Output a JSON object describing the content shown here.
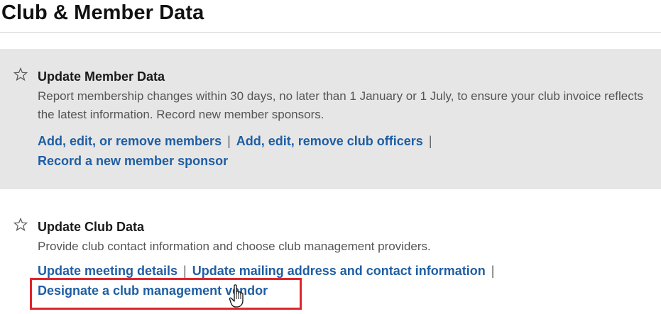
{
  "page": {
    "title": "Club & Member Data"
  },
  "sections": [
    {
      "icon": "star-outline-icon",
      "title": "Update Member Data",
      "description": "Report membership changes within 30 days, no later than 1 January or 1 July, to ensure your club invoice reflects the latest information. Record new member sponsors.",
      "links": [
        "Add, edit, or remove members",
        "Add, edit, remove club officers",
        "Record a new member sponsor"
      ]
    },
    {
      "icon": "star-outline-icon",
      "title": "Update Club Data",
      "description": "Provide club contact information and choose club management providers.",
      "links": [
        "Update meeting details",
        "Update mailing address and contact information",
        "Designate a club management vendor"
      ]
    }
  ],
  "separator": "|",
  "colors": {
    "link": "#1f5ea3",
    "highlight": "#e0252a",
    "shaded_bg": "#e6e6e6"
  },
  "cursor": "hand-pointer-icon"
}
